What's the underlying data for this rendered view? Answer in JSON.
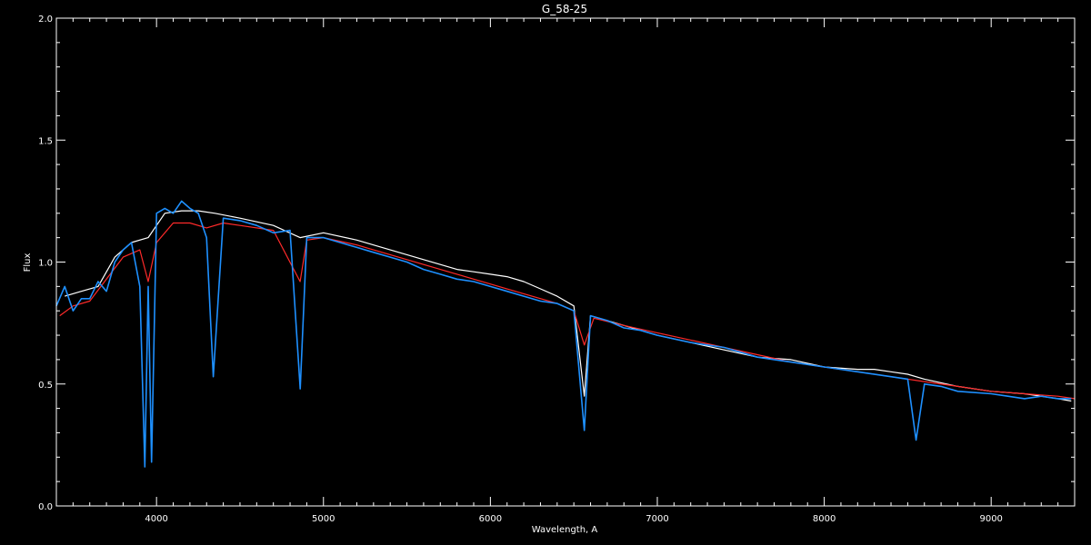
{
  "chart_data": {
    "type": "line",
    "title": "G_58-25",
    "xlabel": "Wavelength, A",
    "ylabel": "Flux",
    "xlim": [
      3400,
      9500
    ],
    "ylim": [
      0.0,
      2.0
    ],
    "x_ticks": [
      4000,
      5000,
      6000,
      7000,
      8000,
      9000
    ],
    "x_tick_labels": [
      "4000",
      "5000",
      "6000",
      "7000",
      "8000",
      "9000"
    ],
    "y_ticks": [
      0.0,
      0.5,
      1.0,
      1.5,
      2.0
    ],
    "y_tick_labels": [
      "0.0",
      "0.5",
      "1.0",
      "1.5",
      "2.0"
    ],
    "grid": false,
    "background": "#000000",
    "axis_color": "#ffffff",
    "series": [
      {
        "color": "#ffffff",
        "x": [
          3450,
          3550,
          3650,
          3750,
          3850,
          3950,
          4050,
          4150,
          4250,
          4350,
          4500,
          4700,
          4860,
          5000,
          5200,
          5400,
          5600,
          5800,
          5900,
          6000,
          6100,
          6200,
          6300,
          6400,
          6500,
          6563,
          6600,
          6700,
          6800,
          6900,
          7000,
          7200,
          7400,
          7600,
          7800,
          8000,
          8200,
          8300,
          8400,
          8500,
          8600,
          8800,
          9000,
          9200,
          9400,
          9480
        ],
        "y": [
          0.86,
          0.88,
          0.9,
          1.02,
          1.08,
          1.1,
          1.2,
          1.21,
          1.21,
          1.2,
          1.18,
          1.15,
          1.1,
          1.12,
          1.09,
          1.05,
          1.01,
          0.97,
          0.96,
          0.95,
          0.94,
          0.92,
          0.89,
          0.86,
          0.82,
          0.45,
          0.78,
          0.76,
          0.74,
          0.72,
          0.7,
          0.67,
          0.64,
          0.61,
          0.6,
          0.57,
          0.56,
          0.56,
          0.55,
          0.54,
          0.52,
          0.49,
          0.47,
          0.46,
          0.44,
          0.43
        ]
      },
      {
        "color": "#ff2a2a",
        "x": [
          3420,
          3500,
          3600,
          3700,
          3800,
          3900,
          3950,
          4000,
          4100,
          4200,
          4300,
          4400,
          4500,
          4700,
          4860,
          4900,
          5000,
          5200,
          5400,
          5600,
          5800,
          6000,
          6200,
          6400,
          6500,
          6563,
          6620,
          6800,
          7000,
          7200,
          7400,
          7600,
          7800,
          8000,
          8200,
          8400,
          8600,
          8800,
          9000,
          9200,
          9400,
          9500
        ],
        "y": [
          0.78,
          0.82,
          0.84,
          0.93,
          1.02,
          1.05,
          0.92,
          1.08,
          1.16,
          1.16,
          1.14,
          1.16,
          1.15,
          1.13,
          0.92,
          1.09,
          1.1,
          1.07,
          1.03,
          0.99,
          0.95,
          0.91,
          0.87,
          0.83,
          0.8,
          0.66,
          0.77,
          0.74,
          0.71,
          0.68,
          0.65,
          0.62,
          0.59,
          0.57,
          0.55,
          0.53,
          0.51,
          0.49,
          0.47,
          0.46,
          0.45,
          0.44
        ]
      },
      {
        "color": "#1e90ff",
        "x": [
          3400,
          3450,
          3500,
          3550,
          3600,
          3650,
          3700,
          3750,
          3800,
          3850,
          3900,
          3930,
          3950,
          3970,
          4000,
          4050,
          4100,
          4150,
          4200,
          4250,
          4300,
          4340,
          4400,
          4500,
          4600,
          4700,
          4800,
          4861,
          4900,
          5000,
          5100,
          5200,
          5300,
          5400,
          5500,
          5600,
          5700,
          5800,
          5900,
          6000,
          6100,
          6200,
          6300,
          6400,
          6500,
          6563,
          6600,
          6700,
          6800,
          6900,
          7000,
          7200,
          7400,
          7500,
          7600,
          7700,
          7800,
          8000,
          8200,
          8400,
          8500,
          8550,
          8600,
          8700,
          8800,
          9000,
          9100,
          9200,
          9300,
          9400,
          9450,
          9480
        ],
        "y": [
          0.82,
          0.9,
          0.8,
          0.85,
          0.85,
          0.92,
          0.88,
          1.0,
          1.05,
          1.08,
          0.9,
          0.16,
          0.9,
          0.18,
          1.2,
          1.22,
          1.2,
          1.25,
          1.22,
          1.2,
          1.1,
          0.53,
          1.18,
          1.17,
          1.15,
          1.12,
          1.13,
          0.48,
          1.1,
          1.1,
          1.08,
          1.06,
          1.04,
          1.02,
          1.0,
          0.97,
          0.95,
          0.93,
          0.92,
          0.9,
          0.88,
          0.86,
          0.84,
          0.83,
          0.8,
          0.31,
          0.78,
          0.76,
          0.73,
          0.72,
          0.7,
          0.67,
          0.65,
          0.63,
          0.61,
          0.6,
          0.59,
          0.57,
          0.55,
          0.53,
          0.52,
          0.27,
          0.5,
          0.49,
          0.47,
          0.46,
          0.45,
          0.44,
          0.45,
          0.44,
          0.44,
          0.44
        ]
      }
    ]
  }
}
